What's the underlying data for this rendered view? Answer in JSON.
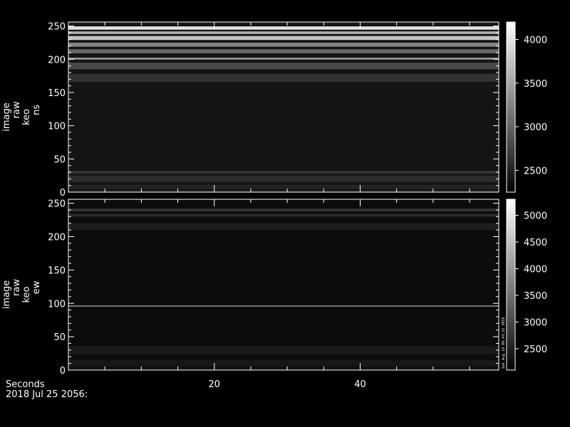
{
  "chart_data": [
    {
      "type": "heatmap",
      "ylabel_lines": [
        "image",
        "raw",
        "keo",
        "ns"
      ],
      "xlim": [
        0,
        59
      ],
      "ylim": [
        0,
        256
      ],
      "yticks": [
        0,
        50,
        100,
        150,
        200,
        250
      ],
      "colorbar": {
        "range": [
          2250,
          4200
        ],
        "ticks": [
          2500,
          3000,
          3500,
          4000
        ]
      },
      "bands": [
        {
          "y": 247,
          "w": 5,
          "v": 4150
        },
        {
          "y": 240,
          "w": 4,
          "v": 3700
        },
        {
          "y": 232,
          "w": 6,
          "v": 3900
        },
        {
          "y": 222,
          "w": 6,
          "v": 3350
        },
        {
          "y": 212,
          "w": 6,
          "v": 3100
        },
        {
          "y": 201,
          "w": 3,
          "v": 3500
        },
        {
          "y": 190,
          "w": 10,
          "v": 2850
        },
        {
          "y": 172,
          "w": 12,
          "v": 2650
        },
        {
          "y": 30,
          "w": 4,
          "v": 2700
        },
        {
          "y": 20,
          "w": 10,
          "v": 2600
        },
        {
          "y": 8,
          "w": 6,
          "v": 2550
        },
        {
          "y": 2,
          "w": 3,
          "v": 2500
        }
      ],
      "base_value": 2400
    },
    {
      "type": "heatmap",
      "ylabel_lines": [
        "image",
        "raw",
        "keo",
        "ew"
      ],
      "xlim": [
        0,
        59
      ],
      "ylim": [
        0,
        256
      ],
      "yticks": [
        0,
        50,
        100,
        150,
        200,
        250
      ],
      "colorbar": {
        "range": [
          2100,
          5300
        ],
        "ticks": [
          2500,
          3000,
          3500,
          4000,
          4500,
          5000
        ]
      },
      "bands": [
        {
          "y": 240,
          "w": 4,
          "v": 2800
        },
        {
          "y": 232,
          "w": 4,
          "v": 2700
        },
        {
          "y": 215,
          "w": 10,
          "v": 2500
        },
        {
          "y": 96,
          "w": 1,
          "v": 5200
        },
        {
          "y": 30,
          "w": 12,
          "v": 2450
        },
        {
          "y": 10,
          "w": 10,
          "v": 2400
        },
        {
          "y": 2,
          "w": 3,
          "v": 2350
        }
      ],
      "base_value": 2250
    }
  ],
  "xaxis": {
    "ticks": [
      20,
      40
    ],
    "label": "Seconds"
  },
  "date_label": "2018 Jul 25 2056:",
  "stamp": "Sat Aug 18 09:43:16 2018"
}
